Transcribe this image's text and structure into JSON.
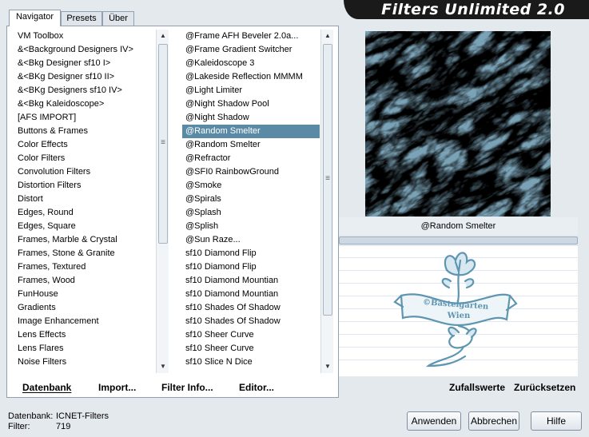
{
  "app": {
    "title": "Filters Unlimited 2.0"
  },
  "tabs": [
    {
      "label": "Navigator"
    },
    {
      "label": "Presets"
    },
    {
      "label": "Über"
    }
  ],
  "categories": [
    "VM Toolbox",
    "&<Background Designers IV>",
    "&<Bkg Designer sf10 I>",
    "&<BKg Designer sf10 II>",
    "&<BKg Designers sf10 IV>",
    "&<Bkg Kaleidoscope>",
    "[AFS IMPORT]",
    "Buttons & Frames",
    "Color Effects",
    "Color Filters",
    "Convolution Filters",
    "Distortion Filters",
    "Distort",
    "Edges, Round",
    "Edges, Square",
    "Frames, Marble & Crystal",
    "Frames, Stone & Granite",
    "Frames, Textured",
    "Frames, Wood",
    "FunHouse",
    "Gradients",
    "Image Enhancement",
    "Lens Effects",
    "Lens Flares",
    "Noise Filters"
  ],
  "filters": [
    "@Frame AFH Beveler 2.0a...",
    "@Frame Gradient Switcher",
    "@Kaleidoscope 3",
    "@Lakeside Reflection MMMM",
    "@Light Limiter",
    "@Night Shadow Pool",
    "@Night Shadow",
    "@Random Smelter",
    "@Random Smelter",
    "@Refractor",
    "@SFI0 RainbowGround",
    "@Smoke",
    "@Spirals",
    "@Splash",
    "@Splish",
    "@Sun Raze...",
    "sf10 Diamond Flip",
    "sf10 Diamond Flip",
    "sf10 Diamond Mountian",
    "sf10 Diamond Mountian",
    "sf10 Shades Of Shadow",
    "sf10 Shades Of Shadow",
    "sf10 Sheer Curve",
    "sf10 Sheer Curve",
    "sf10 Slice N Dice"
  ],
  "selected_filter_index": 7,
  "preview": {
    "effect_name": "@Random Smelter",
    "watermark_line1": "©Bastelgarten",
    "watermark_line2": "Wien"
  },
  "links": {
    "datenbank": "Datenbank",
    "import": "Import...",
    "filter_info": "Filter Info...",
    "editor": "Editor...",
    "random": "Zufallswerte",
    "reset": "Zurücksetzen"
  },
  "status": {
    "db_label": "Datenbank:",
    "db_value": "ICNET-Filters",
    "filter_label": "Filter:",
    "filter_count": "719"
  },
  "buttons": {
    "apply": "Anwenden",
    "cancel": "Abbrechen",
    "help": "Hilfe"
  },
  "colors": {
    "selection": "#5b8aa6",
    "banner": "#1a1a1a",
    "preview_base": "#7aa2b6"
  }
}
